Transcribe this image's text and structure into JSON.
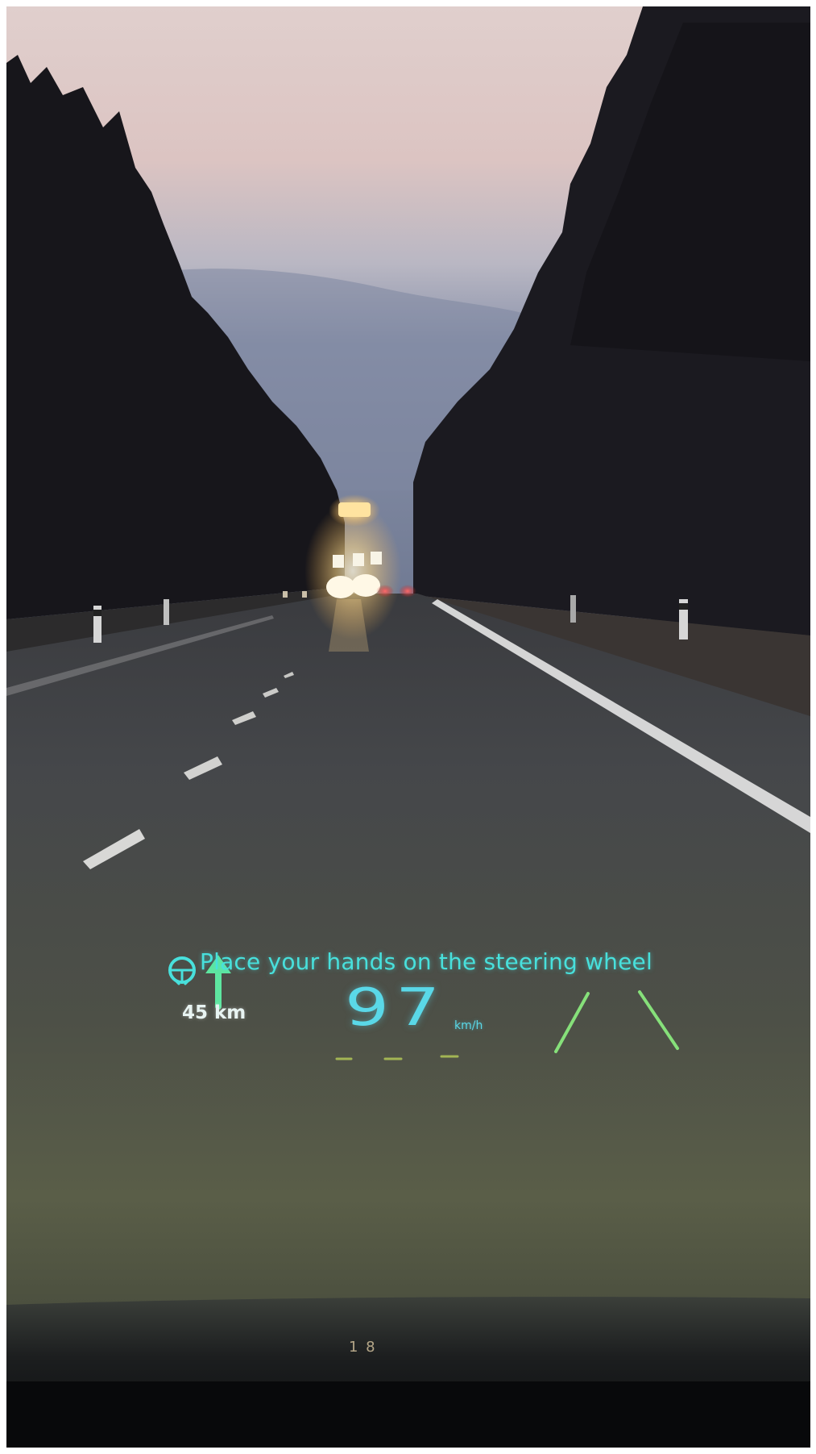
{
  "hud": {
    "message": "Place your hands on the steering wheel",
    "distance": "45 km",
    "speed": "97",
    "speed_unit": "km/h",
    "odometer_glimpse": "1 8"
  },
  "icons": {
    "warning": "steering-wheel-icon",
    "navigation": "straight-arrow-icon",
    "lane_assist": "lane-lines-icon"
  },
  "colors": {
    "hud_cyan": "#48e0dc",
    "hud_green": "#7ee08a",
    "hud_white": "#e8f4f2",
    "sky_top": "#e2cccc",
    "sky_bottom": "#8a93ad",
    "trees": "#1b1a1f",
    "road": "#3c3e40",
    "hood": "#14161a"
  }
}
